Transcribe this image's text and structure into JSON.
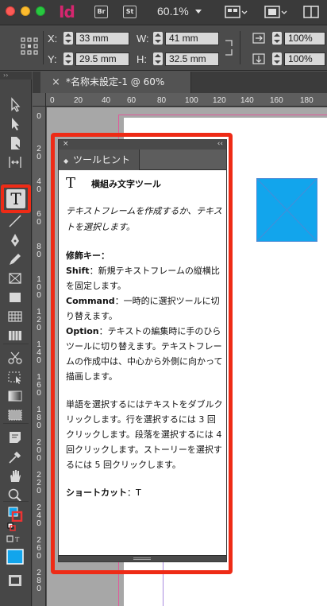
{
  "app": {
    "logo_text": "Id",
    "bridge_buttons": [
      "Br",
      "St"
    ],
    "zoom_level": "60.1%",
    "brand_color": "#d6266f",
    "highlight_color": "#ee2b16"
  },
  "control_panel": {
    "x_label": "X:",
    "x_value": "33 mm",
    "y_label": "Y:",
    "y_value": "29.5 mm",
    "w_label": "W:",
    "w_value": "41 mm",
    "h_label": "H:",
    "h_value": "32.5 mm",
    "scale_x": "100%",
    "scale_y": "100%"
  },
  "document": {
    "tab_title": "*名称未設定-1 @ 60%",
    "tab_close": "×",
    "ruler_h_numbers": [
      "0",
      "20",
      "40",
      "60",
      "80",
      "100",
      "120",
      "140",
      "160",
      "180"
    ],
    "ruler_v_numbers": [
      "0",
      "20",
      "40",
      "60",
      "80",
      "100",
      "120",
      "140",
      "160",
      "180",
      "200",
      "220",
      "240",
      "260",
      "280"
    ],
    "object_fill": "#12a5ec"
  },
  "tools": {
    "type_tool_glyph": "T",
    "grip": "››"
  },
  "tooltip_panel": {
    "close": "×",
    "collapse": "‹‹",
    "tab_arrows": "◆",
    "tab_label": "ツールヒント",
    "tool_glyph": "T",
    "tool_name": "横組み文字ツール",
    "description": "テキストフレームを作成するか、テキストを選択します。",
    "modifiers_title": "修飾キー：",
    "shift_key": "Shift",
    "shift_text": "：新規テキストフレームの縦横比を固定します。",
    "command_key": "Command",
    "command_text": "：一時的に選択ツールに切り替えます。",
    "option_key": "Option",
    "option_text": "：テキストの編集時に手のひらツールに切り替えます。テキストフレームの作成中は、中心から外側に向かって描画します。",
    "selection_text": "単語を選択するにはテキストをダブルクリックします。行を選択するには 3 回クリックします。段落を選択するには 4 回クリックします。ストーリーを選択するには 5 回クリックします。",
    "shortcut_label": "ショートカット",
    "shortcut_value": "：T"
  }
}
